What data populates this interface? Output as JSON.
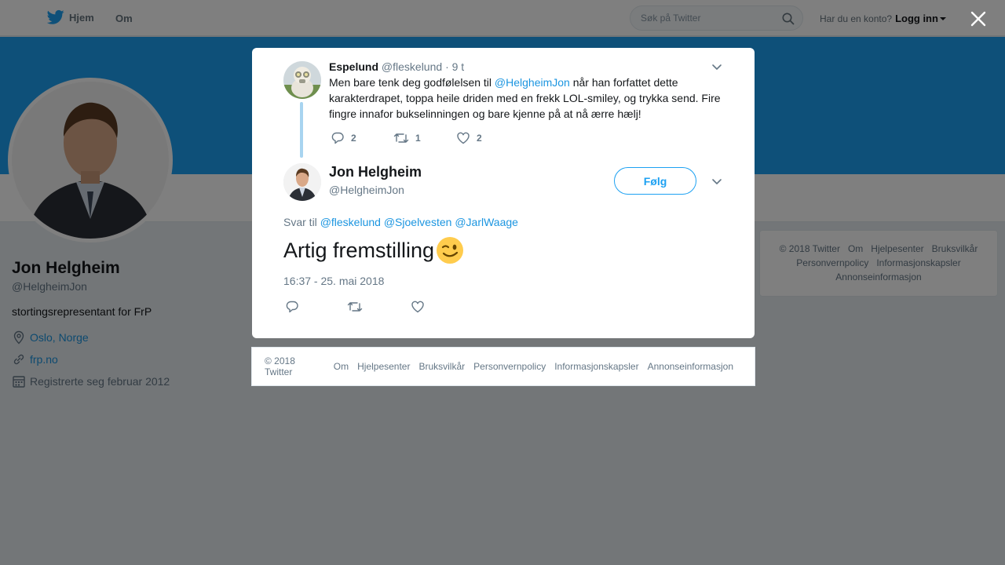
{
  "nav": {
    "home_label": "Hjem",
    "about_label": "Om",
    "search_placeholder": "Søk på Twitter",
    "account_prompt": "Har du en konto?",
    "login_label": "Logg inn"
  },
  "profile": {
    "name": "Jon Helgheim",
    "handle": "@HelgheimJon",
    "bio": "stortingsrepresentant for FrP",
    "location": "Oslo, Norge",
    "website": "frp.no",
    "joined": "Registrerte seg februar 2012"
  },
  "side_footer": {
    "items": [
      "© 2018 Twitter",
      "Om",
      "Hjelpesenter",
      "Bruksvilkår",
      "Personvernpolicy",
      "Informasjonskapsler",
      "Annonseinformasjon"
    ]
  },
  "parent_tweet": {
    "author_name": "Espelund",
    "author_handle": "@fleskelund",
    "time": "· 9 t",
    "text_before": "Men bare tenk deg godfølelsen til ",
    "mention": "@HelgheimJon",
    "text_after": " når han forfattet dette karakterdrapet, toppa heile driden med en frekk LOL-smiley, og trykka send. Fire fingre innafor bukselinningen og bare kjenne på at nå ærre hælj!",
    "replies": "2",
    "retweets": "1",
    "likes": "2"
  },
  "main_tweet": {
    "author_name": "Jon Helgheim",
    "author_handle": "@HelgheimJon",
    "follow_label": "Følg",
    "reply_prefix": "Svar til",
    "reply_mentions": [
      "@fleskelund",
      "@Sjoelvesten",
      "@JarlWaage"
    ],
    "text": "Artig fremstilling",
    "timestamp": "16:37 - 25. mai 2018"
  },
  "modal_footer": {
    "items": [
      "© 2018 Twitter",
      "Om",
      "Hjelpesenter",
      "Bruksvilkår",
      "Personvernpolicy",
      "Informasjonskapsler",
      "Annonseinformasjon"
    ]
  },
  "colors": {
    "brand_blue": "#1da1f2",
    "link_blue": "#1b95e0",
    "overlay": "rgba(0,0,0,0.5)"
  },
  "icons": {
    "logo": "twitter-bird-icon",
    "search": "search-icon",
    "close": "close-icon",
    "reply": "reply-icon",
    "retweet": "retweet-icon",
    "like": "heart-icon",
    "location": "location-pin-icon",
    "link": "link-icon",
    "calendar": "calendar-icon",
    "menu": "chevron-down-icon",
    "emoji": "winking-face-emoji"
  }
}
